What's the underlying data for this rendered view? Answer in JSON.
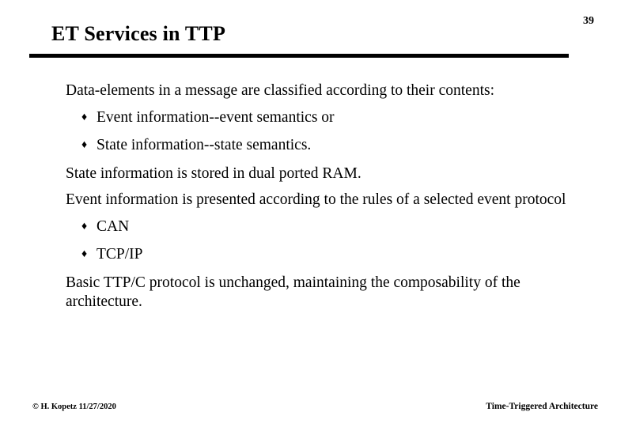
{
  "slide": {
    "title": "ET Services in TTP",
    "page_number": "39",
    "accent_color": "#000000",
    "background_color": "#ffffff",
    "text_color": "#000000"
  },
  "body": {
    "intro": "Data-elements in a message are classified according to their contents:",
    "bullet_glyph": "♦",
    "classification_bullets": [
      {
        "label": "Event information--event semantics or"
      },
      {
        "label": "State information--state semantics."
      }
    ],
    "state_statement": "State information is stored in dual ported RAM.",
    "event_statement": "Event information is presented according to the rules of a selected event protocol",
    "protocol_bullets": [
      {
        "label": "CAN"
      },
      {
        "label": "TCP/IP"
      }
    ],
    "closing_statement": "Basic TTP/C protocol is unchanged, maintaining the composability of the architecture."
  },
  "footer": {
    "left": "© H. Kopetz  11/27/2020",
    "right": "Time-Triggered Architecture"
  }
}
